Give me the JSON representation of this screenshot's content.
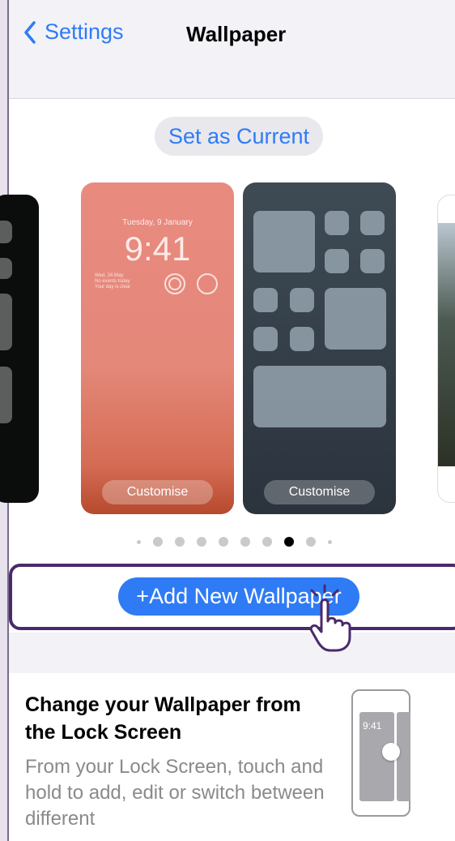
{
  "nav": {
    "back_label": "Settings",
    "title": "Wallpaper"
  },
  "set_current_label": "Set as Current",
  "lock_preview": {
    "date": "Tuesday, 9 January",
    "time": "9:41",
    "widget_lines": [
      "Wed, 24 May",
      "No events today",
      "Your day is clear"
    ]
  },
  "customise_label": "Customise",
  "add_button_label": "Add New Wallpaper",
  "page_dots": {
    "count": 10,
    "active_index": 7
  },
  "info": {
    "title": "Change your Wallpaper from the Lock Screen",
    "body": "From your Lock Screen, touch and hold to add, edit or switch between different",
    "illustration_time": "9:41"
  },
  "colors": {
    "accent": "#2f7bf5",
    "highlight": "#4a2a6b"
  }
}
